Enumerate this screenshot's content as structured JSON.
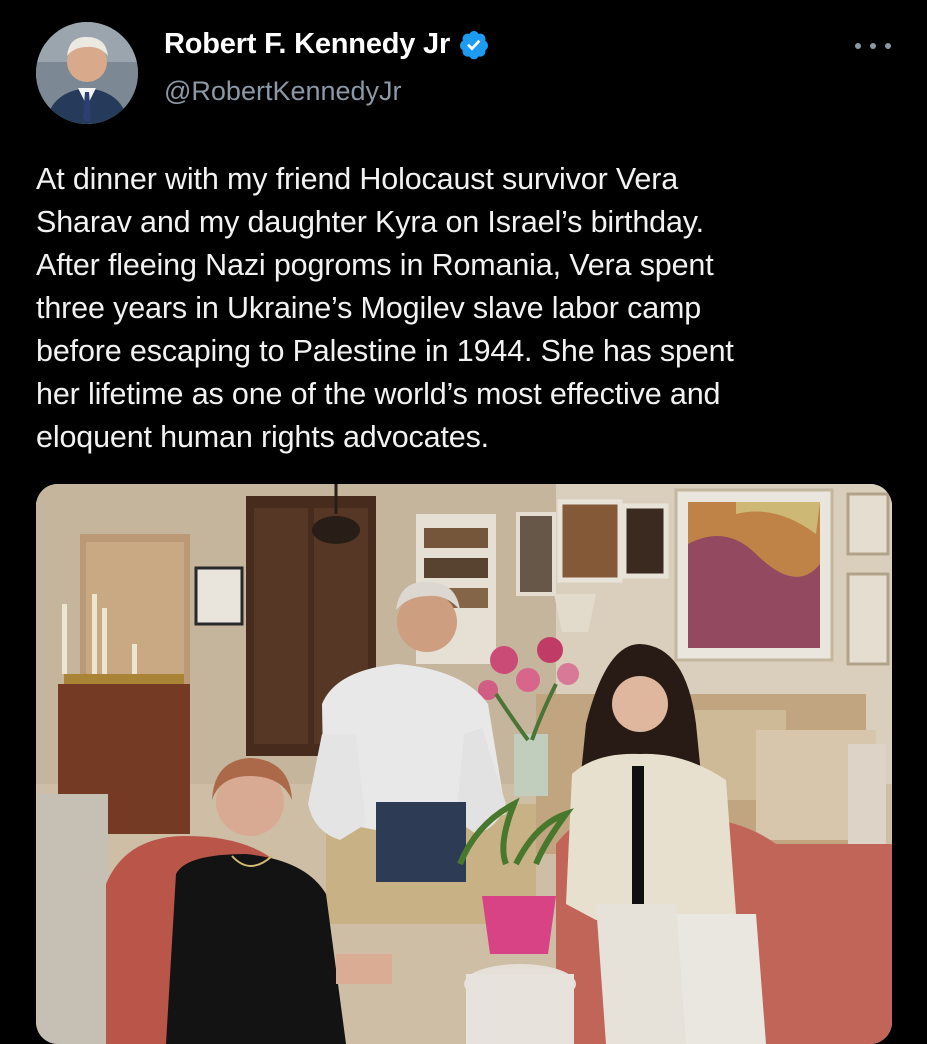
{
  "post": {
    "author": {
      "display_name": "Robert F. Kennedy Jr",
      "handle": "@RobertKennedyJr",
      "verified": true,
      "avatar_icon": "profile-photo",
      "verified_icon": "verified-check-badge-icon",
      "verified_color": "#1d9bf0"
    },
    "more_icon": "more-options-ellipsis-icon",
    "text": "At dinner with my friend Holocaust survivor Vera\nSharav and my daughter Kyra on Israel’s birthday.\nAfter fleeing Nazi pogroms in Romania, Vera spent\nthree years in Ukraine’s Mogilev slave labor camp\nbefore escaping to Palestine in 1944. She has spent\nher lifetime as one of the world’s most effective and\neloquent human rights advocates.",
    "media": {
      "type": "photo"
    }
  },
  "colors": {
    "background": "#000000",
    "text_primary": "#e7e9ea",
    "text_secondary": "#8b98a5"
  }
}
